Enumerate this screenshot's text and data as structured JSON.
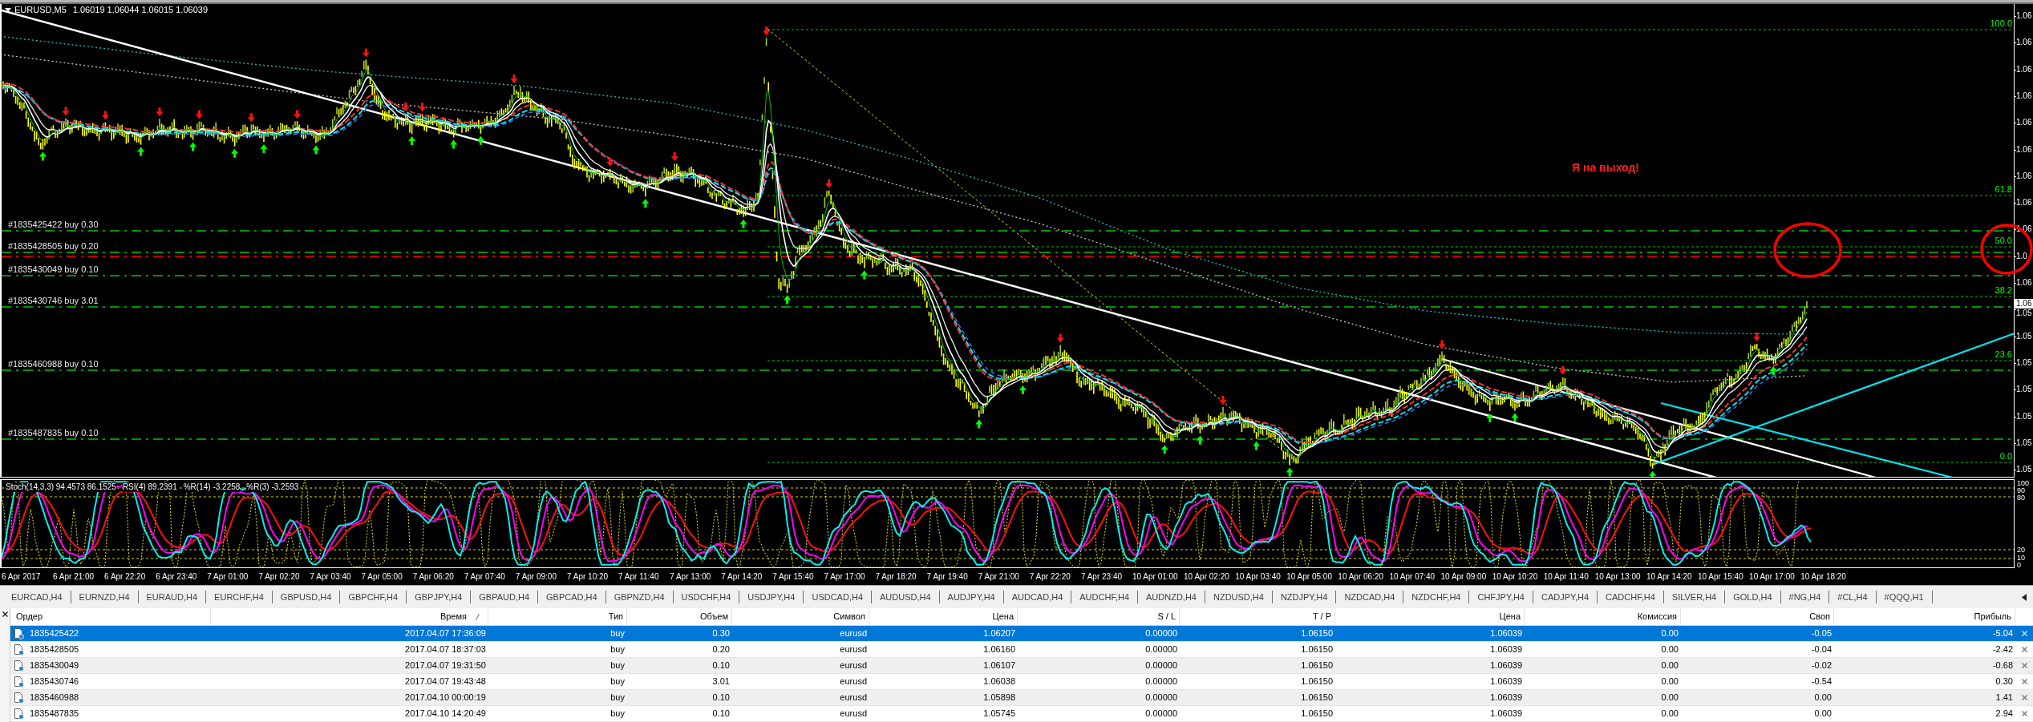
{
  "chart": {
    "symbol": "EURUSD,M5",
    "quotes": "1.06019 1.06044 1.06015 1.06039",
    "annotation": "Я на выход!",
    "order_labels": [
      "#1835425422 buy 0.30",
      "#1835428505 buy 0.20",
      "#1835430049 buy 0.10",
      "#1835430746 buy 3.01",
      "#1835460988 buy 0.10",
      "#1835487835 buy 0.10"
    ],
    "fib_levels": [
      "100.0",
      "61.8",
      "50.0",
      "38.2",
      "23.6",
      "0.0"
    ],
    "price_axis": {
      "labels": [
        "1.06",
        "1.06",
        "1.06",
        "1.06",
        "1.06",
        "1.06",
        "1.06",
        "1.06",
        "1.06",
        "1.0",
        "1.06",
        "1.05",
        "1.05",
        "1.05",
        "1.05",
        "1.05",
        "1.05",
        "1.05"
      ],
      "current": "1.06"
    }
  },
  "indicator": {
    "legend": [
      "Stoch(14,3,3) 94.4573 86.1525",
      "RSI(4) 89.2391",
      "%R(14) -3.2258",
      "%R(3) -3.2593"
    ],
    "levels": [
      "100",
      "90",
      "80",
      "20",
      "10",
      "0"
    ]
  },
  "time_axis": [
    "6 Apr 2017",
    "6 Apr 21:00",
    "6 Apr 22:20",
    "6 Apr 23:40",
    "7 Apr 01:00",
    "7 Apr 02:20",
    "7 Apr 03:40",
    "7 Apr 05:00",
    "7 Apr 06:20",
    "7 Apr 07:40",
    "7 Apr 09:00",
    "7 Apr 10:20",
    "7 Apr 11:40",
    "7 Apr 13:00",
    "7 Apr 14:20",
    "7 Apr 15:40",
    "7 Apr 17:00",
    "7 Apr 18:20",
    "7 Apr 19:40",
    "7 Apr 21:00",
    "7 Apr 22:20",
    "7 Apr 23:40",
    "10 Apr 01:00",
    "10 Apr 02:20",
    "10 Apr 03:40",
    "10 Apr 05:00",
    "10 Apr 06:20",
    "10 Apr 07:40",
    "10 Apr 09:00",
    "10 Apr 10:20",
    "10 Apr 11:40",
    "10 Apr 13:00",
    "10 Apr 14:20",
    "10 Apr 15:40",
    "10 Apr 17:00",
    "10 Apr 18:20"
  ],
  "tabs": [
    {
      "label": "EURCAD,H4",
      "selected": false
    },
    {
      "label": "EURNZD,H4",
      "selected": false
    },
    {
      "label": "EURAUD,H4",
      "selected": false
    },
    {
      "label": "EURCHF,H4",
      "selected": false
    },
    {
      "label": "GBPUSD,H4",
      "selected": false
    },
    {
      "label": "GBPCHF,H4",
      "selected": false
    },
    {
      "label": "GBPJPY,H4",
      "selected": false
    },
    {
      "label": "GBPAUD,H4",
      "selected": false
    },
    {
      "label": "GBPCAD,H4",
      "selected": false
    },
    {
      "label": "GBPNZD,H4",
      "selected": false
    },
    {
      "label": "USDCHF,H4",
      "selected": false
    },
    {
      "label": "USDJPY,H4",
      "selected": false
    },
    {
      "label": "USDCAD,H4",
      "selected": false
    },
    {
      "label": "AUDUSD,H4",
      "selected": false
    },
    {
      "label": "AUDJPY,H4",
      "selected": false
    },
    {
      "label": "AUDCAD,H4",
      "selected": false
    },
    {
      "label": "AUDCHF,H4",
      "selected": false
    },
    {
      "label": "AUDNZD,H4",
      "selected": false
    },
    {
      "label": "NZDUSD,H4",
      "selected": false
    },
    {
      "label": "NZDJPY,H4",
      "selected": false
    },
    {
      "label": "NZDCAD,H4",
      "selected": false
    },
    {
      "label": "NZDCHF,H4",
      "selected": false
    },
    {
      "label": "CHFJPY,H4",
      "selected": false
    },
    {
      "label": "CADJPY,H4",
      "selected": false
    },
    {
      "label": "CADCHF,H4",
      "selected": false
    },
    {
      "label": "SILVER,H4",
      "selected": false
    },
    {
      "label": "GOLD,H4",
      "selected": false
    },
    {
      "label": "#NG,H4",
      "selected": false
    },
    {
      "label": "#CL,H4",
      "selected": false
    },
    {
      "label": "#QQQ,H1",
      "selected": false
    }
  ],
  "terminal": {
    "columns": [
      {
        "label": "Ордер",
        "sorted": false
      },
      {
        "label": "Время",
        "sorted": true
      },
      {
        "label": "Тип",
        "sorted": false
      },
      {
        "label": "Объем",
        "sorted": false
      },
      {
        "label": "Символ",
        "sorted": false
      },
      {
        "label": "Цена",
        "sorted": false
      },
      {
        "label": "S / L",
        "sorted": false
      },
      {
        "label": "T / P",
        "sorted": false
      },
      {
        "label": "Цена",
        "sorted": false
      },
      {
        "label": "Комиссия",
        "sorted": false
      },
      {
        "label": "Своп",
        "sorted": false
      },
      {
        "label": "Прибыль",
        "sorted": false
      }
    ],
    "rows": [
      {
        "selected": true,
        "cells": [
          "1835425422",
          "2017.04.07 17:36:09",
          "buy",
          "0.30",
          "eurusd",
          "1.06207",
          "0.00000",
          "1.06150",
          "1.06039",
          "0.00",
          "-0.05",
          "-5.04"
        ]
      },
      {
        "selected": false,
        "cells": [
          "1835428505",
          "2017.04.07 18:37:03",
          "buy",
          "0.20",
          "eurusd",
          "1.06160",
          "0.00000",
          "1.06150",
          "1.06039",
          "0.00",
          "-0.04",
          "-2.42"
        ]
      },
      {
        "selected": false,
        "cells": [
          "1835430049",
          "2017.04.07 19:31:50",
          "buy",
          "0.10",
          "eurusd",
          "1.06107",
          "0.00000",
          "1.06150",
          "1.06039",
          "0.00",
          "-0.02",
          "-0.68"
        ]
      },
      {
        "selected": false,
        "cells": [
          "1835430746",
          "2017.04.07 19:43:48",
          "buy",
          "3.01",
          "eurusd",
          "1.06038",
          "0.00000",
          "1.06150",
          "1.06039",
          "0.00",
          "-0.54",
          "0.30"
        ]
      },
      {
        "selected": false,
        "cells": [
          "1835460988",
          "2017.04.10 00:00:19",
          "buy",
          "0.10",
          "eurusd",
          "1.05898",
          "0.00000",
          "1.06150",
          "1.06039",
          "0.00",
          "0.00",
          "1.41"
        ]
      },
      {
        "selected": false,
        "cells": [
          "1835487835",
          "2017.04.10 14:20:49",
          "buy",
          "0.10",
          "eurusd",
          "1.05745",
          "0.00000",
          "1.06150",
          "1.06039",
          "0.00",
          "0.00",
          "2.94"
        ]
      }
    ]
  }
}
